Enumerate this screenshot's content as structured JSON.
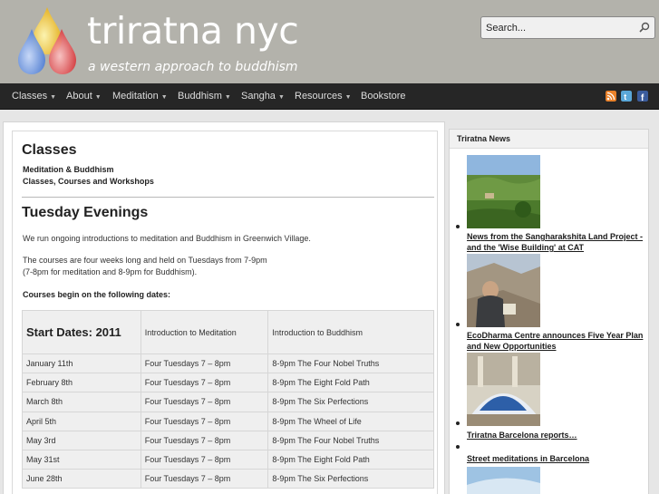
{
  "header": {
    "title": "triratna nyc",
    "tagline": "a western approach to buddhism",
    "search_placeholder": "Search..."
  },
  "nav": {
    "items": [
      {
        "label": "Classes",
        "dropdown": true
      },
      {
        "label": "About",
        "dropdown": true
      },
      {
        "label": "Meditation",
        "dropdown": true
      },
      {
        "label": "Buddhism",
        "dropdown": true
      },
      {
        "label": "Sangha",
        "dropdown": true
      },
      {
        "label": "Resources",
        "dropdown": true
      },
      {
        "label": "Bookstore",
        "dropdown": false
      }
    ],
    "social_icons": [
      "rss-icon",
      "twitter-icon",
      "facebook-icon"
    ]
  },
  "main": {
    "title": "Classes",
    "subtitle1": "Meditation & Buddhism",
    "subtitle2": "Classes, Courses and Workshops",
    "section_title": "Tuesday Evenings",
    "intro": "We run ongoing introductions to meditation and Buddhism in Greenwich Village.",
    "courses_line1": "The courses are four weeks long and held on Tuesdays from 7-9pm",
    "courses_line2": "(7-8pm for meditation and 8-9pm for Buddhism).",
    "courses_begin": "Courses begin on the following dates:",
    "table": {
      "headers": [
        "Start Dates: 2011",
        "Introduction to Meditation",
        "Introduction to Buddhism"
      ],
      "rows": [
        [
          "January 11th",
          "Four Tuesdays 7 – 8pm",
          "8-9pm The Four Nobel Truths"
        ],
        [
          "February 8th",
          "Four Tuesdays 7 – 8pm",
          "8-9pm The Eight Fold Path"
        ],
        [
          "March 8th",
          "Four Tuesdays 7 – 8pm",
          "8-9pm The Six Perfections"
        ],
        [
          "April 5th",
          "Four Tuesdays 7 – 8pm",
          "8-9pm The Wheel of Life"
        ],
        [
          "May 3rd",
          "Four Tuesdays 7 – 8pm",
          "8-9pm The Four Nobel Truths"
        ],
        [
          "May 31st",
          "Four Tuesdays 7 – 8pm",
          "8-9pm The Eight Fold Path"
        ],
        [
          "June 28th",
          "Four Tuesdays 7 – 8pm",
          "8-9pm The Six Perfections"
        ]
      ]
    }
  },
  "sidebar": {
    "title": "Triratna News",
    "news": [
      "News from the Sangharakshita Land Project - and the 'Wise Building' at CAT",
      "EcoDharma Centre announces Five Year Plan and New Opportunities",
      "Triratna Barcelona reports…",
      "Street meditations in Barcelona"
    ]
  },
  "colors": {
    "header_bg": "#b3b2ab",
    "nav_bg": "#262626",
    "page_bg": "#e6e6e6"
  }
}
